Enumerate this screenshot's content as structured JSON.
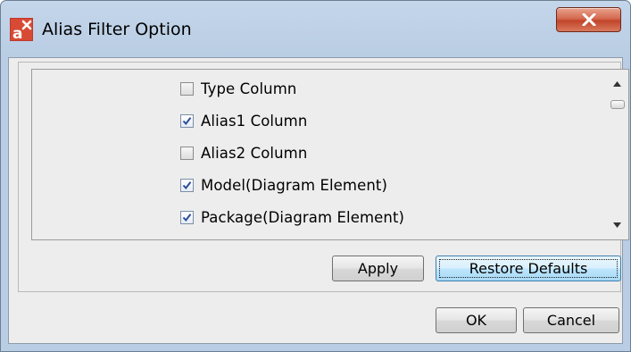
{
  "window": {
    "title": "Alias Filter Option",
    "close_label": "X"
  },
  "filter_list": {
    "items": [
      {
        "label": "Type Column",
        "checked": false
      },
      {
        "label": "Alias1 Column",
        "checked": true
      },
      {
        "label": "Alias2 Column",
        "checked": false
      },
      {
        "label": "Model(Diagram Element)",
        "checked": true
      },
      {
        "label": "Package(Diagram Element)",
        "checked": true
      }
    ]
  },
  "buttons": {
    "apply": "Apply",
    "restore_defaults": "Restore Defaults",
    "ok": "OK",
    "cancel": "Cancel"
  },
  "colors": {
    "title_bar": "#b9cde4",
    "close_button": "#c2452a",
    "dialog_background": "#ededed",
    "focus_button": "#bee6fd"
  }
}
